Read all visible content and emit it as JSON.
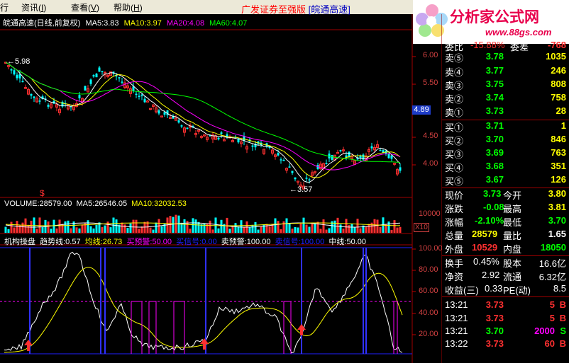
{
  "menu": {
    "items": [
      {
        "label": "行",
        "key": ""
      },
      {
        "label": "资讯",
        "key": "I"
      },
      {
        "label": "查看",
        "key": "V"
      },
      {
        "label": "帮助",
        "key": "H"
      }
    ],
    "title_red": "广发证券至强版",
    "title_blue": "[皖通高速]"
  },
  "logo": {
    "name": "分析家公式网",
    "url": "www.88gs.com"
  },
  "ma_bar": {
    "stock": "皖通高速(日线,前复权)",
    "ma5": "MA5:3.83",
    "ma10": "MA10:3.97",
    "ma20": "MA20:4.08",
    "ma60": "MA60:4.07"
  },
  "colors": {
    "ma5": "#ffffff",
    "ma10": "#ffff00",
    "ma20": "#ff00ff",
    "ma60": "#00ff00",
    "up": "#ff3030",
    "down": "#00ffff",
    "axis": "#c00000"
  },
  "price_axis": [
    "6.00",
    "5.50",
    "5.00",
    "4.50",
    "4.00"
  ],
  "current_price_tag": "4.89",
  "annotations": {
    "high": "←5.98",
    "low": "←3.57"
  },
  "volume_bar": {
    "vol": "VOLUME:28579.00",
    "ma5": "MA5:26546.05",
    "ma10": "MA10:32032.53"
  },
  "volume_axis": {
    "label": "10000",
    "unit": "X10"
  },
  "indicator_bar": {
    "name": "机构操盘",
    "trend": "趋势线:0.57",
    "avg": "均线:26.73",
    "buy_warn": "买预警:50.00",
    "buy_sig": "买信号:0.00",
    "sell_warn": "卖预警:100.00",
    "sell_sig": "卖信号:100.00",
    "mid": "中线:50.00"
  },
  "indicator_axis": [
    "100.00",
    "80.00",
    "60.00",
    "40.00",
    "20.00"
  ],
  "quote": {
    "top_row": {
      "label": "委比",
      "value": "-15.88%",
      "label2": "委差",
      "value2": "-768"
    },
    "asks": [
      {
        "label": "卖⑤",
        "price": "3.78",
        "vol": "1035"
      },
      {
        "label": "卖④",
        "price": "3.77",
        "vol": "246"
      },
      {
        "label": "卖③",
        "price": "3.75",
        "vol": "808"
      },
      {
        "label": "卖②",
        "price": "3.74",
        "vol": "758"
      },
      {
        "label": "卖①",
        "price": "3.73",
        "vol": "28"
      }
    ],
    "bids": [
      {
        "label": "买①",
        "price": "3.71",
        "vol": "1"
      },
      {
        "label": "买②",
        "price": "3.70",
        "vol": "846"
      },
      {
        "label": "买③",
        "price": "3.69",
        "vol": "763"
      },
      {
        "label": "买④",
        "price": "3.68",
        "vol": "351"
      },
      {
        "label": "买⑤",
        "price": "3.67",
        "vol": "126"
      }
    ],
    "stats": [
      {
        "l1": "现价",
        "v1": "3.73",
        "l2": "今开",
        "v2": "3.80"
      },
      {
        "l1": "涨跌",
        "v1": "-0.08",
        "l2": "最高",
        "v2": "3.81"
      },
      {
        "l1": "涨幅",
        "v1": "-2.10%",
        "l2": "最低",
        "v2": "3.70"
      },
      {
        "l1": "总量",
        "v1": "28579",
        "l2": "量比",
        "v2": "1.65"
      },
      {
        "l1": "外盘",
        "v1": "10529",
        "l2": "内盘",
        "v2": "18050"
      }
    ],
    "fin": [
      {
        "l1": "换手",
        "v1": "0.45%",
        "l2": "股本",
        "v2": "16.6亿"
      },
      {
        "l1": "净资",
        "v1": "2.92",
        "l2": "流通",
        "v2": "6.32亿"
      },
      {
        "l1": "收益(三)",
        "v1": "0.33",
        "l2": "PE(动)",
        "v2": "8.5"
      }
    ],
    "ticks": [
      {
        "time": "13:21",
        "price": "3.73",
        "vol": "5",
        "side": "B"
      },
      {
        "time": "13:21",
        "price": "3.73",
        "vol": "5",
        "side": "B"
      },
      {
        "time": "13:21",
        "price": "3.70",
        "vol": "2000",
        "side": "S"
      },
      {
        "time": "13:22",
        "price": "3.73",
        "vol": "60",
        "side": "B"
      }
    ]
  }
}
